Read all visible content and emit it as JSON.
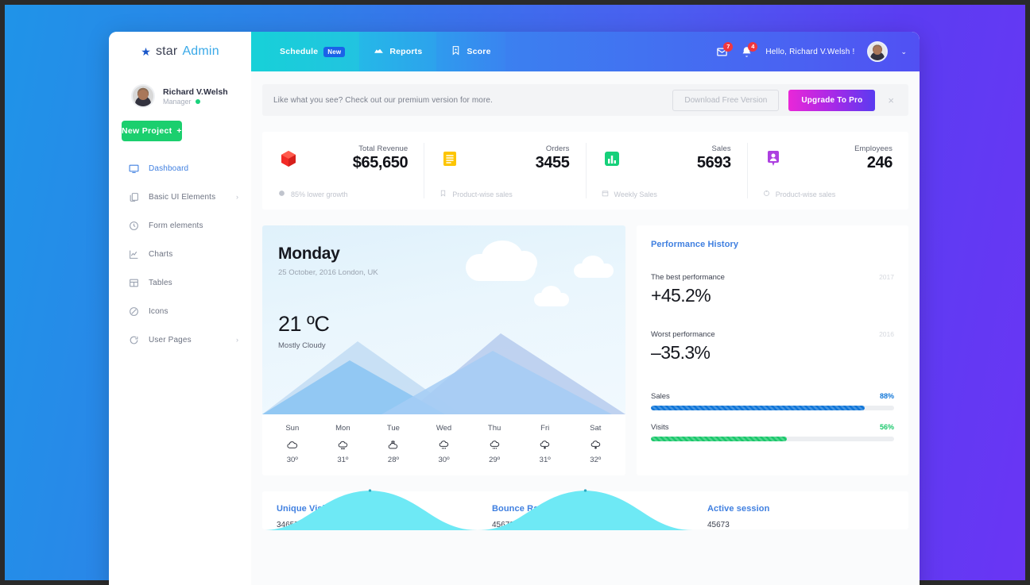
{
  "brand": {
    "part1": "star",
    "part2": "Admin",
    "icon": "star-icon"
  },
  "sidebar": {
    "profile": {
      "name": "Richard V.Welsh",
      "role": "Manager"
    },
    "new_project_label": "New Project",
    "new_project_plus": "+",
    "items": [
      {
        "label": "Dashboard",
        "icon": "monitor-icon",
        "active": true,
        "chevron": ""
      },
      {
        "label": "Basic UI Elements",
        "icon": "copy-icon",
        "active": false,
        "chevron": "›"
      },
      {
        "label": "Form elements",
        "icon": "clock-icon",
        "active": false,
        "chevron": ""
      },
      {
        "label": "Charts",
        "icon": "chart-line-icon",
        "active": false,
        "chevron": ""
      },
      {
        "label": "Tables",
        "icon": "table-icon",
        "active": false,
        "chevron": ""
      },
      {
        "label": "Icons",
        "icon": "circle-slash-icon",
        "active": false,
        "chevron": ""
      },
      {
        "label": "User Pages",
        "icon": "refresh-icon",
        "active": false,
        "chevron": "›"
      }
    ]
  },
  "navbar": {
    "tabs": [
      {
        "label": "Schedule",
        "badge": "New",
        "icon": ""
      },
      {
        "label": "Reports",
        "badge": "",
        "icon": "report-icon"
      },
      {
        "label": "Score",
        "badge": "",
        "icon": "bookmark-icon"
      }
    ],
    "email_badge": "7",
    "bell_badge": "4",
    "greeting": "Hello, Richard V.Welsh !",
    "caret": "⌄"
  },
  "promo": {
    "text": "Like what you see? Check out our premium version for more.",
    "download_label": "Download Free Version",
    "upgrade_label": "Upgrade To Pro",
    "close": "×"
  },
  "stats": [
    {
      "label": "Total Revenue",
      "value": "$65,650",
      "note": "85% lower growth",
      "icon": "cube-icon",
      "color": "#f22a26",
      "note_icon": "gear-icon"
    },
    {
      "label": "Orders",
      "value": "3455",
      "note": "Product-wise sales",
      "icon": "receipt-icon",
      "color": "#fdc500",
      "note_icon": "bookmark-icon"
    },
    {
      "label": "Sales",
      "value": "5693",
      "note": "Weekly Sales",
      "icon": "bar-chart-icon",
      "color": "#16d07a",
      "note_icon": "calendar-icon"
    },
    {
      "label": "Employees",
      "value": "246",
      "note": "Product-wise sales",
      "icon": "user-pin-icon",
      "color": "#ad3fe0",
      "note_icon": "target-icon"
    }
  ],
  "weather": {
    "day": "Monday",
    "date": "25 October, 2016 London, UK",
    "temperature": "21 ºC",
    "condition": "Mostly Cloudy",
    "forecast": [
      {
        "day": "Sun",
        "temp": "30º",
        "icon": "cloud-icon"
      },
      {
        "day": "Mon",
        "temp": "31º",
        "icon": "cloud-drizzle-icon"
      },
      {
        "day": "Tue",
        "temp": "28º",
        "icon": "cloud-sun-icon"
      },
      {
        "day": "Wed",
        "temp": "30º",
        "icon": "cloud-rain-icon"
      },
      {
        "day": "Thu",
        "temp": "29º",
        "icon": "cloud-rain-icon"
      },
      {
        "day": "Fri",
        "temp": "31º",
        "icon": "cloud-snow-icon"
      },
      {
        "day": "Sat",
        "temp": "32º",
        "icon": "cloud-snow-icon"
      }
    ]
  },
  "performance": {
    "title": "Performance History",
    "best_label": "The best performance",
    "best_year": "2017",
    "best_value": "+45.2%",
    "worst_label": "Worst performance",
    "worst_year": "2016",
    "worst_value": "–35.3%",
    "bars": [
      {
        "name": "Sales",
        "pct_text": "88%",
        "pct": 88,
        "color": "#1076d8"
      },
      {
        "name": "Visits",
        "pct_text": "56%",
        "pct": 56,
        "color": "#1bc86c"
      }
    ]
  },
  "mini_charts": [
    {
      "title": "Unique Visitors",
      "value": "34657"
    },
    {
      "title": "Bounce Rate",
      "value": "45673"
    },
    {
      "title": "Active session",
      "value": "45673"
    }
  ],
  "colors": {
    "accent_blue": "#3f7fe0",
    "green": "#1bcf6e",
    "cyan_chart": "#6ee9f5"
  }
}
